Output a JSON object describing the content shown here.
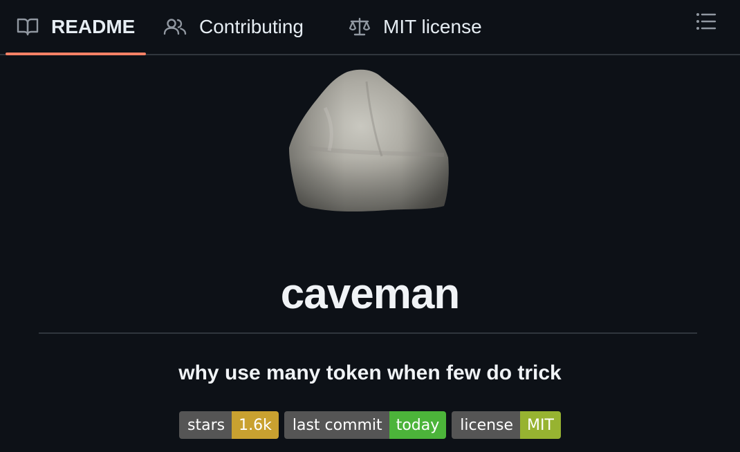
{
  "tabs": [
    {
      "label": "README",
      "icon": "book-icon",
      "active": true
    },
    {
      "label": "Contributing",
      "icon": "people-icon",
      "active": false
    },
    {
      "label": "MIT license",
      "icon": "law-icon",
      "active": false
    }
  ],
  "outline_icon": "list-unordered-icon",
  "repo": {
    "title": "caveman",
    "tagline": "why use many token when few do trick",
    "logo": "rock-image"
  },
  "badges": [
    {
      "label": "stars",
      "value": "1.6k",
      "color": "#c9a130"
    },
    {
      "label": "last commit",
      "value": "today",
      "color": "#4cb43a"
    },
    {
      "label": "license",
      "value": "MIT",
      "color": "#97b331"
    }
  ],
  "colors": {
    "background": "#0d1117",
    "active_tab_underline": "#f78166",
    "divider": "#30363d",
    "text": "#e6edf3"
  }
}
